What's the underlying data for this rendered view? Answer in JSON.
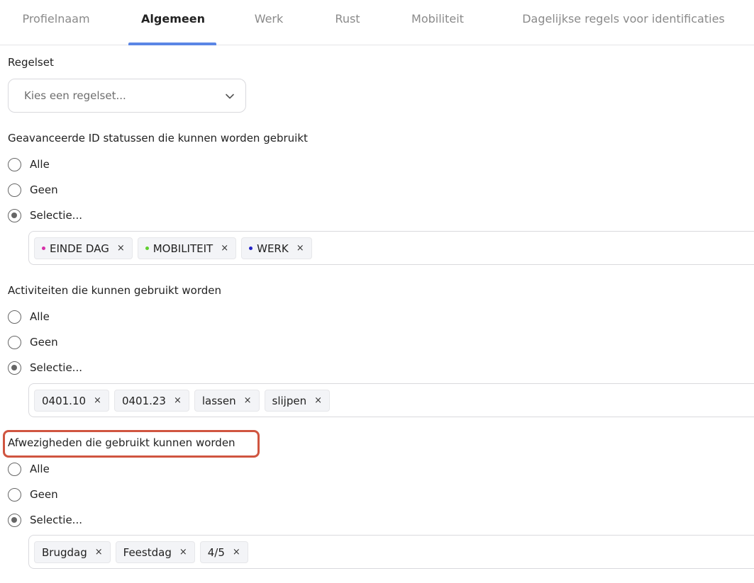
{
  "tabs": [
    {
      "label": "Profielnaam"
    },
    {
      "label": "Algemeen"
    },
    {
      "label": "Werk"
    },
    {
      "label": "Rust"
    },
    {
      "label": "Mobiliteit"
    },
    {
      "label": "Dagelijkse regels voor identificaties"
    }
  ],
  "active_tab": "Algemeen",
  "ruleset": {
    "label": "Regelset",
    "placeholder": "Kies een regelset...",
    "icon": "chevron-down-icon"
  },
  "sections": [
    {
      "label": "Geavanceerde ID statussen die kunnen worden gebruikt",
      "options": [
        "Alle",
        "Geen",
        "Selectie..."
      ],
      "selected": "Selectie...",
      "tags": [
        {
          "label": "EINDE DAG",
          "color": "#d62fa8"
        },
        {
          "label": "MOBILITEIT",
          "color": "#5fcf2f"
        },
        {
          "label": "WERK",
          "color": "#2323c8"
        }
      ]
    },
    {
      "label": "Activiteiten die kunnen gebruikt worden",
      "options": [
        "Alle",
        "Geen",
        "Selectie..."
      ],
      "selected": "Selectie...",
      "tags": [
        {
          "label": "0401.10"
        },
        {
          "label": "0401.23"
        },
        {
          "label": "lassen"
        },
        {
          "label": "slijpen"
        }
      ]
    },
    {
      "label": "Afwezigheden die gebruikt kunnen worden",
      "options": [
        "Alle",
        "Geen",
        "Selectie..."
      ],
      "selected": "Selectie...",
      "highlighted": true,
      "tags": [
        {
          "label": "Brugdag"
        },
        {
          "label": "Feestdag"
        },
        {
          "label": "4/5"
        }
      ]
    }
  ],
  "tag_remove_glyph": "×",
  "colors": {
    "accent": "#5b86e5",
    "highlight": "#d05540"
  }
}
